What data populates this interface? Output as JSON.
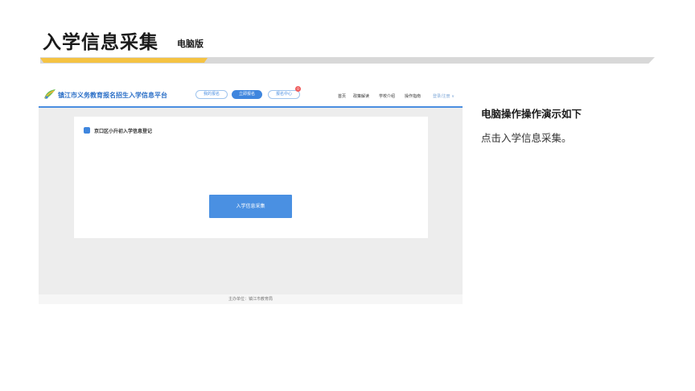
{
  "slide": {
    "title": "入学信息采集",
    "subtitle": "电脑版",
    "accent_color": "#f5c343"
  },
  "screenshot": {
    "site_title": "镇江市义务教育报名招生入学信息平台",
    "pills": [
      "我的报名",
      "立即报名",
      "报名中心"
    ],
    "notification_badge": "0",
    "nav": [
      "首页",
      "政策解读",
      "学校介绍",
      "操作指南"
    ],
    "login_link": "登录/注册 ∨",
    "registration_title": "京口区小升初入学信息登记",
    "collect_button": "入学信息采集",
    "footer": "主办单位：镇江市教育局",
    "primary_color": "#3f86de"
  },
  "instructions": {
    "heading": "电脑操作操作演示如下",
    "text": "点击入学信息采集。"
  }
}
